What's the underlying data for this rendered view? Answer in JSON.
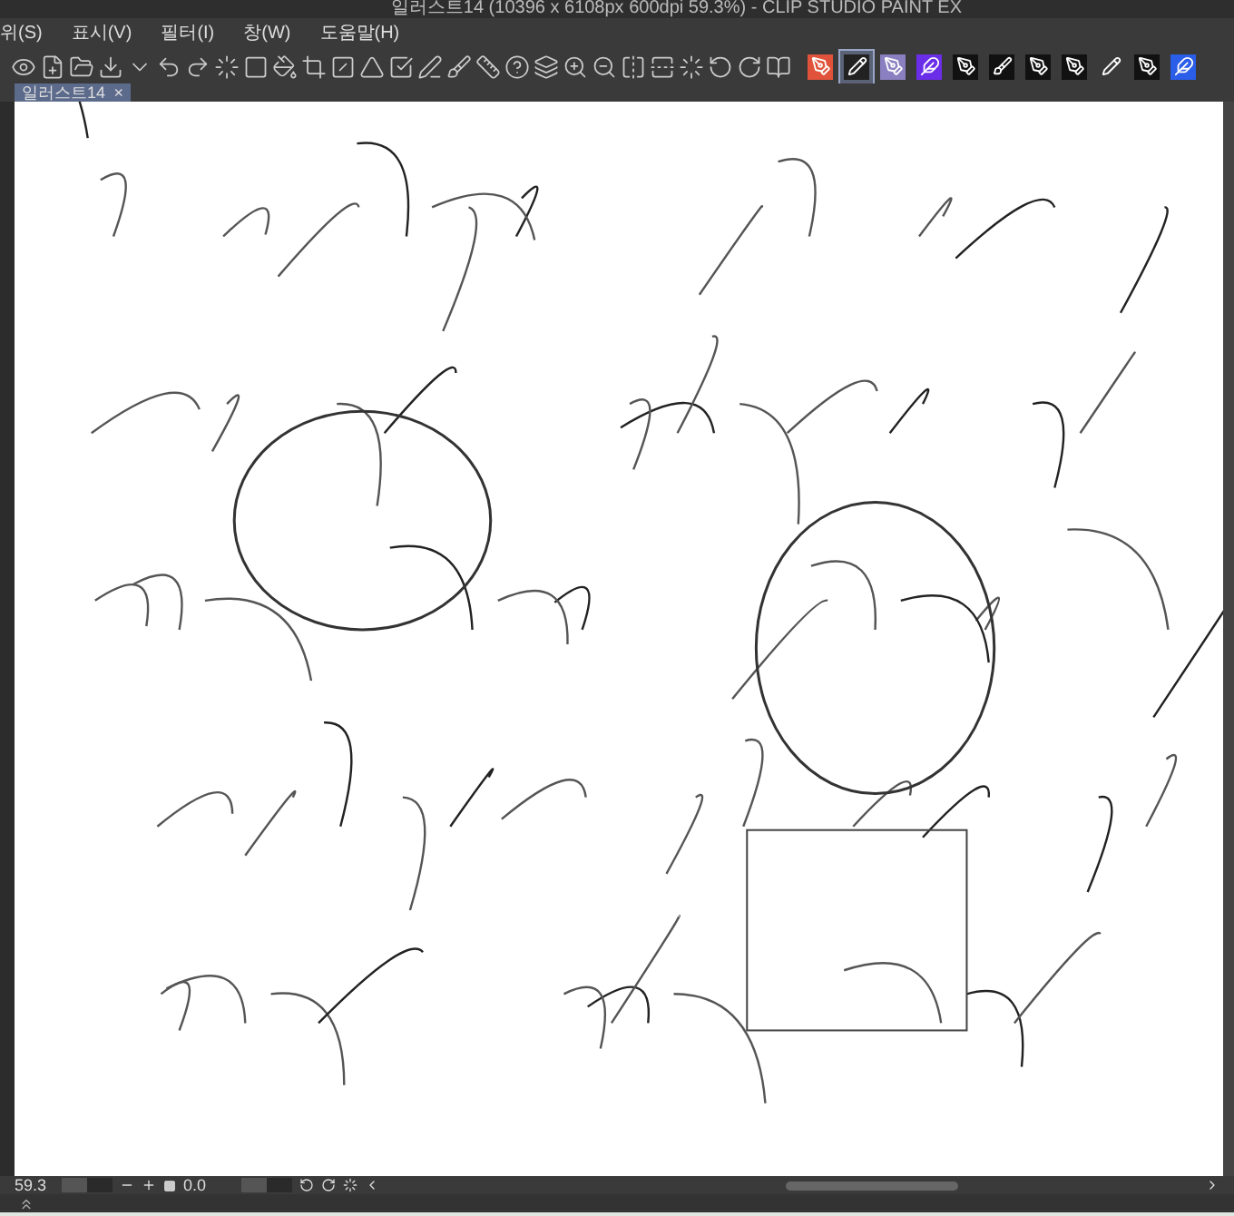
{
  "window": {
    "title": "일러스트14 (10396 x 6108px 600dpi 59.3%) - CLIP STUDIO PAINT EX"
  },
  "menu": [
    "위(S)",
    "표시(V)",
    "필터(I)",
    "창(W)",
    "도움말(H)"
  ],
  "brush_tools": [
    {
      "selected": false
    },
    {
      "selected": true
    },
    {
      "selected": false
    },
    {
      "selected": false
    },
    {
      "selected": false
    },
    {
      "selected": false
    },
    {
      "selected": false
    },
    {
      "selected": false
    },
    {
      "selected": false
    },
    {
      "selected": false
    },
    {
      "selected": false
    }
  ],
  "tab": {
    "label": "일러스트14",
    "close": "×"
  },
  "status_bar": {
    "zoom": "59.3",
    "zoom_slider": {
      "level": 0.5
    },
    "rotation": "0.0",
    "rotation_slider": {
      "level": 0.5
    }
  }
}
